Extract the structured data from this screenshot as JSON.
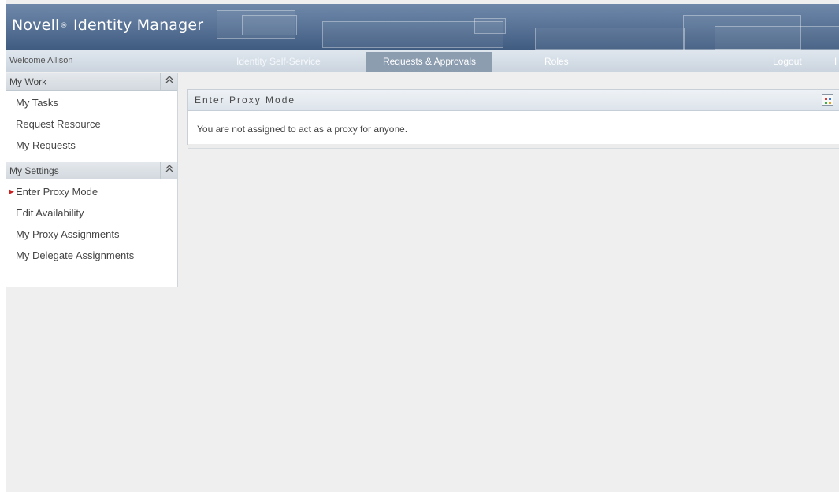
{
  "header": {
    "title_prefix": "Novell",
    "registered_mark": "®",
    "title_suffix": " Identity Manager"
  },
  "nav": {
    "welcome": "Welcome Allison",
    "tabs": [
      {
        "label": "Identity Self-Service",
        "active": false
      },
      {
        "label": "Requests & Approvals",
        "active": true
      },
      {
        "label": "Roles",
        "active": false
      }
    ],
    "logout": "Logout",
    "more": "H"
  },
  "sidebar": {
    "sections": [
      {
        "title": "My Work",
        "collapse_icon": "double-chevron-up-icon",
        "items": [
          "My Tasks",
          "Request Resource",
          "My Requests"
        ]
      },
      {
        "title": "My Settings",
        "collapse_icon": "double-chevron-up-icon",
        "items": [
          "Enter Proxy Mode",
          "Edit Availability",
          "My Proxy Assignments",
          "My Delegate Assignments"
        ],
        "active_item": "Enter Proxy Mode"
      }
    ]
  },
  "main": {
    "panel_title": "Enter Proxy Mode",
    "message": "You are not assigned to act as a proxy for anyone.",
    "menu_icon": "panel-menu-icon"
  },
  "colors": {
    "banner": "#5a7598",
    "nav_active": "#8c9db0",
    "active_arrow": "#cc1f1f"
  }
}
